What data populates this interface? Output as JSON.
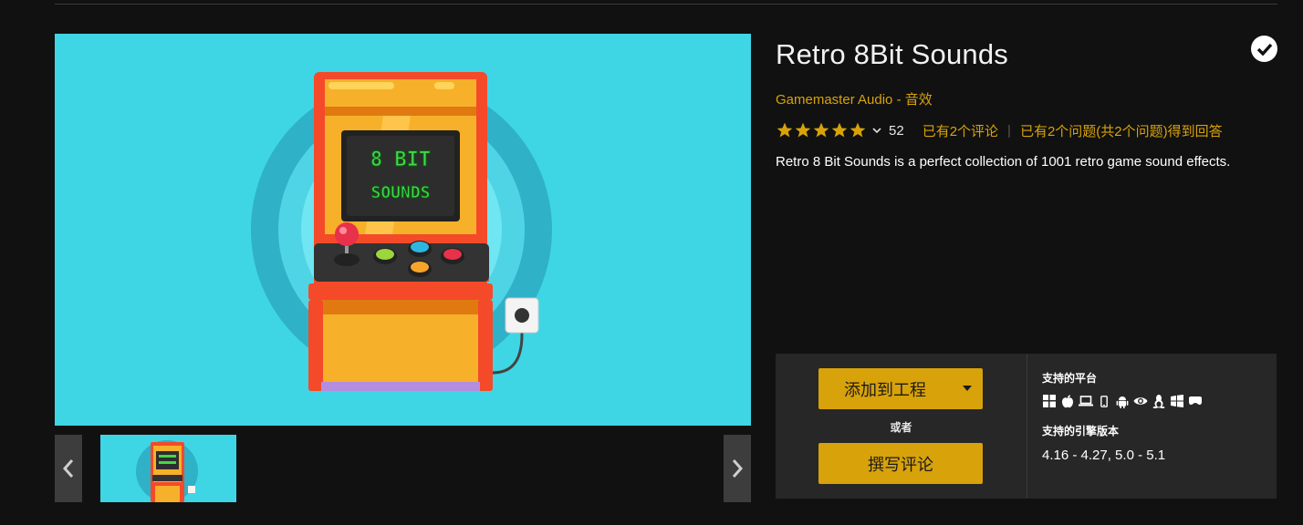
{
  "product": {
    "title": "Retro 8Bit Sounds",
    "seller": "Gamemaster Audio",
    "separator": " - ",
    "category": "音效",
    "rating_value": 5,
    "rating_count": "52",
    "reviews_link": "已有2个评论",
    "questions_link": "已有2个问题(共2个问题)得到回答",
    "description": "Retro 8 Bit Sounds is a perfect collection of 1001 retro game sound effects.",
    "hero_screen_line1": "8 BIT",
    "hero_screen_line2": "SOUNDS"
  },
  "actions": {
    "add_to_project": "添加到工程",
    "or": "或者",
    "write_review": "撰写评论"
  },
  "platforms": {
    "title": "支持的平台",
    "icons": [
      "windows-icon",
      "apple-icon",
      "laptop-icon",
      "mobile-icon",
      "android-icon",
      "eye-icon",
      "linux-icon",
      "windows-store-icon",
      "vr-headset-icon"
    ]
  },
  "engine": {
    "title": "支持的引擎版本",
    "versions": "4.16 - 4.27, 5.0 - 5.1"
  },
  "colors": {
    "accent": "#d8a20a",
    "hero_bg": "#3ed6e4",
    "panel_bg": "#272727",
    "page_bg": "#111111"
  }
}
